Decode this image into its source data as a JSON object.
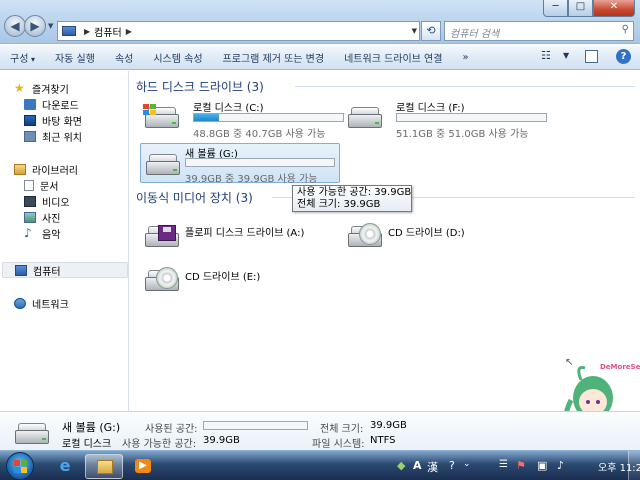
{
  "window": {
    "back_icon": "back-arrow-icon",
    "forward_icon": "forward-arrow-icon",
    "breadcrumb": {
      "root_icon": "computer-icon",
      "item": "컴퓨터"
    },
    "refresh_icon": "refresh-icon",
    "search_placeholder": "컴퓨터 검색",
    "buttons": {
      "minimize": "─",
      "maximize": "□",
      "close": "✕"
    }
  },
  "toolbar": {
    "items": [
      "구성",
      "자동 실행",
      "속성",
      "시스템 속성",
      "프로그램 제거 또는 변경",
      "네트워크 드라이브 연결"
    ],
    "more": "»",
    "help": "?"
  },
  "nav": {
    "favorites": "즐겨찾기",
    "downloads": "다운로드",
    "desktop": "바탕 화면",
    "recent": "최근 위치",
    "libraries": "라이브러리",
    "documents": "문서",
    "videos": "비디오",
    "pictures": "사진",
    "music": "음악",
    "computer": "컴퓨터",
    "network": "네트워크"
  },
  "groups": {
    "hdd": "하드 디스크 드라이브 (3)",
    "removable": "이동식 미디어 장치 (3)"
  },
  "drives": [
    {
      "name": "로컬 디스크 (C:)",
      "info": "48.8GB 중 40.7GB 사용 가능",
      "used_fraction": 0.17
    },
    {
      "name": "로컬 디스크 (F:)",
      "info": "51.1GB 중 51.0GB 사용 가능",
      "used_fraction": 0.0
    },
    {
      "name": "새 볼륨 (G:)",
      "info": "39.9GB 중 39.9GB 사용 가능",
      "used_fraction": 0.0
    }
  ],
  "media": [
    "플로피 디스크 드라이브 (A:)",
    "CD 드라이브 (D:)",
    "CD 드라이브 (E:)"
  ],
  "tooltip": {
    "line1": "사용 가능한 공간: 39.9GB",
    "line2": "전체 크기: 39.9GB"
  },
  "details": {
    "name": "새 볼륨 (G:)",
    "type": "로컬 디스크",
    "used_label": "사용된 공간:",
    "free_label": "사용 가능한 공간:",
    "free_value": "39.9GB",
    "total_label": "전체 크기:",
    "total_value": "39.9GB",
    "fs_label": "파일 시스템:",
    "fs_value": "NTFS"
  },
  "taskbar": {
    "ime_a": "A",
    "ime_han": "漢",
    "time": "오후 11:29"
  },
  "overlay": {
    "watermark": "DeMoreSee"
  },
  "colors": {
    "accent": "#1e3f7a",
    "usage_bar": "#2a95d6",
    "close_red": "#c84a31"
  }
}
